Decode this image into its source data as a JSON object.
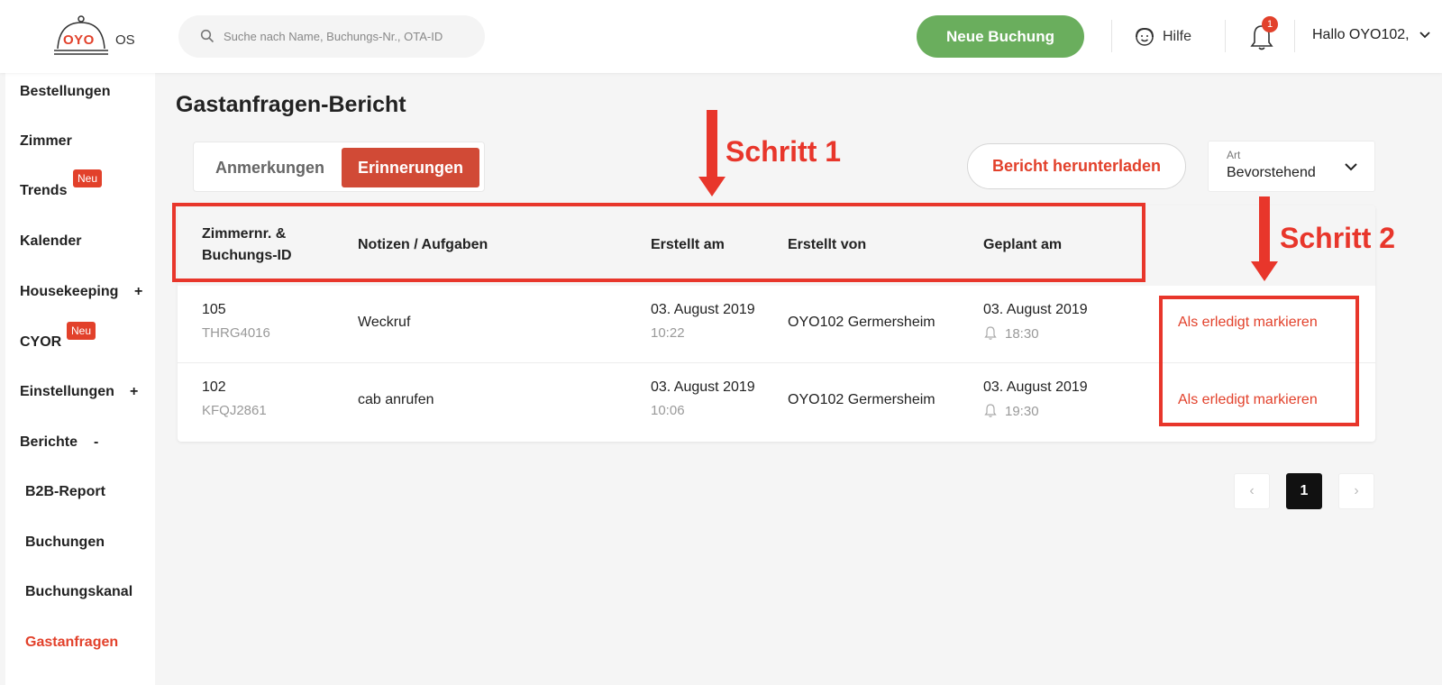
{
  "header": {
    "logo_text": "OYO",
    "logo_suffix": "OS",
    "search_placeholder": "Suche nach Name, Buchungs-Nr., OTA-ID",
    "new_booking_label": "Neue Buchung",
    "help_label": "Hilfe",
    "notification_count": "1",
    "user_greeting": "Hallo OYO102,"
  },
  "sidebar": {
    "items": [
      {
        "label": "Bestellungen"
      },
      {
        "label": "Zimmer"
      },
      {
        "label": "Trends",
        "badge": "Neu"
      },
      {
        "label": "Kalender"
      },
      {
        "label": "Housekeeping",
        "sign": "+"
      },
      {
        "label": "CYOR",
        "badge": "Neu"
      },
      {
        "label": "Einstellungen",
        "sign": "+"
      },
      {
        "label": "Berichte",
        "sign": "-"
      },
      {
        "label": "B2B-Report"
      },
      {
        "label": "Buchungen"
      },
      {
        "label": "Buchungskanal"
      },
      {
        "label": "Gastanfragen"
      }
    ]
  },
  "main": {
    "title": "Gastanfragen-Bericht",
    "tabs": [
      {
        "label": "Anmerkungen"
      },
      {
        "label": "Erinnerungen"
      }
    ],
    "download_label": "Bericht herunterladen",
    "filter": {
      "label": "Art",
      "value": "Bevorstehend"
    },
    "table": {
      "headers": {
        "room_line1": "Zimmernr. &",
        "room_line2": "Buchungs-ID",
        "notes": "Notizen / Aufgaben",
        "created_at": "Erstellt am",
        "created_by": "Erstellt von",
        "scheduled": "Geplant am"
      },
      "rows": [
        {
          "room": "105",
          "booking_id": "THRG4016",
          "note": "Weckruf",
          "created_date": "03. August 2019",
          "created_time": "10:22",
          "created_by": "OYO102 Germersheim",
          "scheduled_date": "03. August 2019",
          "scheduled_time": "18:30",
          "action": "Als erledigt markieren"
        },
        {
          "room": "102",
          "booking_id": "KFQJ2861",
          "note": "cab anrufen",
          "created_date": "03. August 2019",
          "created_time": "10:06",
          "created_by": "OYO102 Germersheim",
          "scheduled_date": "03. August 2019",
          "scheduled_time": "19:30",
          "action": "Als erledigt markieren"
        }
      ]
    },
    "pagination": {
      "prev": "‹",
      "current": "1",
      "next": "›"
    }
  },
  "annotations": {
    "step1": "Schritt 1",
    "step2": "Schritt 2",
    "color": "#e8362b"
  },
  "colors": {
    "accent": "#e2412b",
    "primary_button": "#6aae5d",
    "active_tab": "#d14a36"
  }
}
